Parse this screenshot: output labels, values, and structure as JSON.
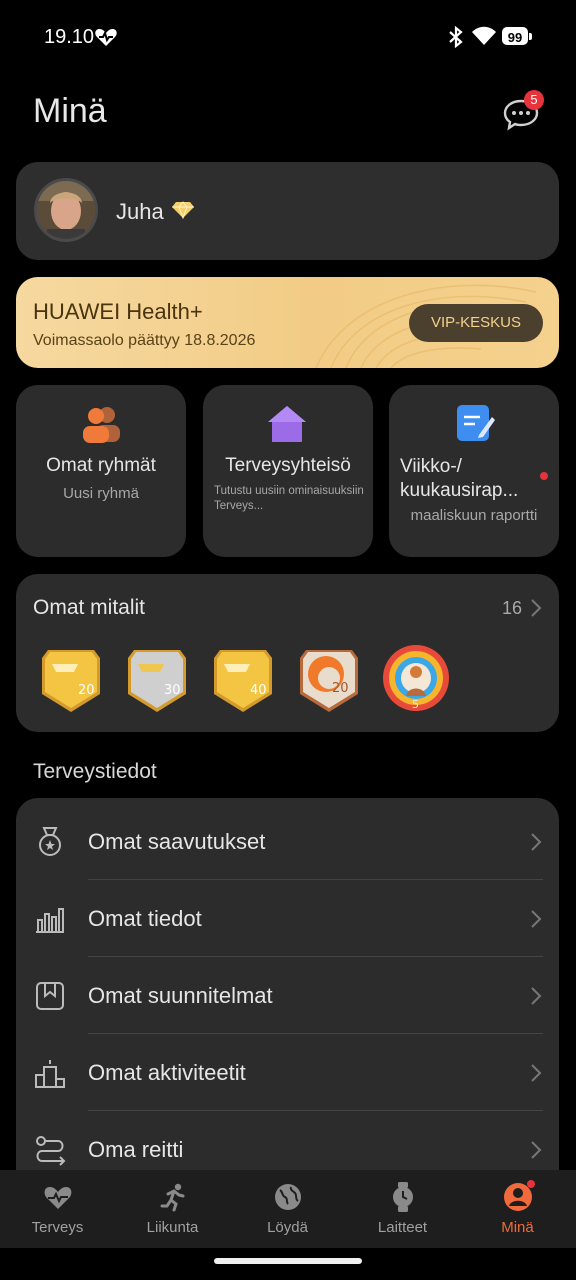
{
  "status_bar": {
    "time": "19.10",
    "battery": "99"
  },
  "header": {
    "title": "Minä",
    "message_badge": "5"
  },
  "profile": {
    "name": "Juha"
  },
  "vip": {
    "title": "HUAWEI Health+",
    "subtitle": "Voimassaolo päättyy 18.8.2026",
    "button": "VIP-KESKUS"
  },
  "tiles": [
    {
      "title": "Omat ryhmät",
      "subtitle": "Uusi ryhmä"
    },
    {
      "title": "Terveysyhteisö",
      "subtitle": "Tutustu uusiin ominaisuuksiin Terveys..."
    },
    {
      "title": "Viikko-/ kuukausirap...",
      "subtitle": "maaliskuun raportti"
    }
  ],
  "medals": {
    "title": "Omat mitalit",
    "count": "16",
    "items": [
      {
        "label": "20",
        "icon": "running-medal-gold-icon"
      },
      {
        "label": "30",
        "icon": "running-medal-silver-icon"
      },
      {
        "label": "40",
        "icon": "running-medal-gold-icon"
      },
      {
        "label": "20",
        "icon": "streak-medal-bronze-icon"
      },
      {
        "label": "5",
        "icon": "ring-medal-icon"
      }
    ]
  },
  "section_title": "Terveystiedot",
  "list": [
    {
      "label": "Omat saavutukset",
      "icon": "medal-icon"
    },
    {
      "label": "Omat tiedot",
      "icon": "bar-chart-icon"
    },
    {
      "label": "Omat suunnitelmat",
      "icon": "plan-icon"
    },
    {
      "label": "Omat aktiviteetit",
      "icon": "podium-icon"
    },
    {
      "label": "Oma reitti",
      "icon": "route-icon"
    }
  ],
  "nav": [
    {
      "label": "Terveys",
      "icon": "heart-icon",
      "active": false
    },
    {
      "label": "Liikunta",
      "icon": "runner-icon",
      "active": false
    },
    {
      "label": "Löydä",
      "icon": "globe-icon",
      "active": false
    },
    {
      "label": "Laitteet",
      "icon": "watch-icon",
      "active": false
    },
    {
      "label": "Minä",
      "icon": "person-icon",
      "active": true
    }
  ],
  "colors": {
    "accent": "#f06a3c",
    "vip_gold": "#f4d18d",
    "badge_red": "#e7343c"
  }
}
